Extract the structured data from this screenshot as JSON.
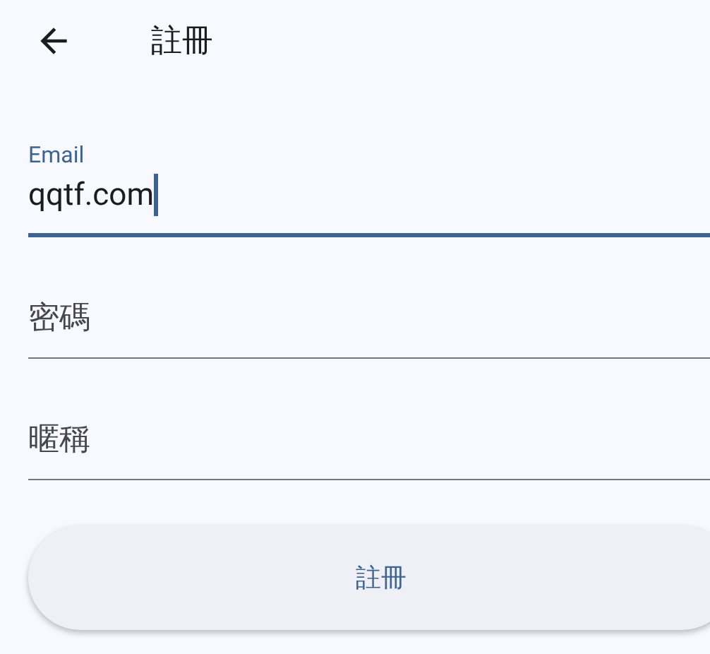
{
  "header": {
    "title": "註冊"
  },
  "fields": [
    {
      "label": "Email",
      "value": "qqtf.com",
      "focused": true
    },
    {
      "placeholder": "密碼",
      "focused": false
    },
    {
      "placeholder": "暱稱",
      "focused": false
    }
  ],
  "submit_button": {
    "label": "註冊"
  }
}
